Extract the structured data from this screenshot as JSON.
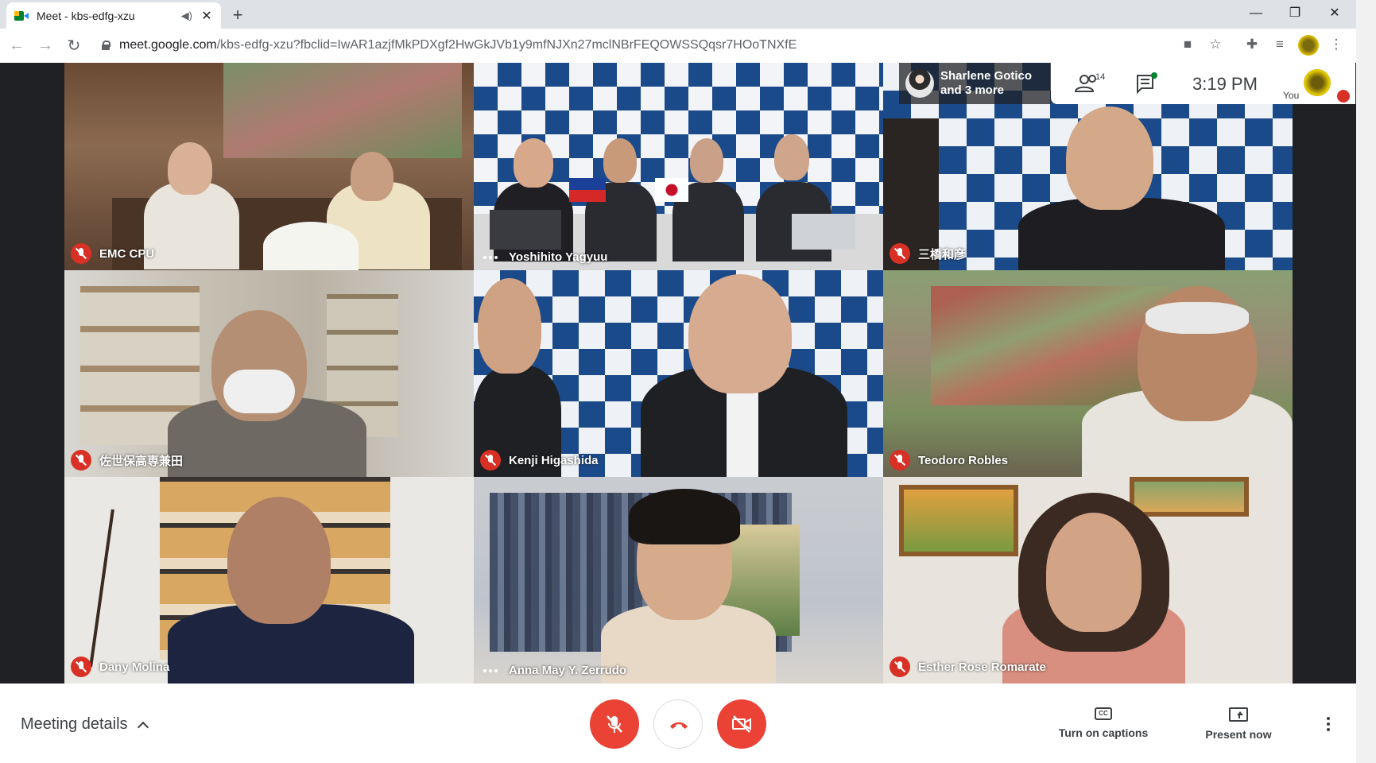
{
  "browser": {
    "tab_title": "Meet - kbs-edfg-xzu",
    "url_host": "meet.google.com",
    "url_rest": "/kbs-edfg-xzu?fbclid=IwAR1azjfMkPDXgf2HwGkJVb1y9mfNJXn27mclNBrFEQOWSSQqsr7HOoTNXfE",
    "new_tab": "+",
    "tab_close": "✕",
    "minimize": "—",
    "maximize": "❐",
    "close": "✕"
  },
  "top_panel": {
    "presenter_line1": "Sharlene Gotico",
    "presenter_line2": "and 3 more",
    "participant_count": "14",
    "time": "3:19 PM",
    "you_label": "You"
  },
  "participants": [
    {
      "name": "EMC CPU",
      "status": "muted"
    },
    {
      "name": "Yoshihito Yagyuu",
      "status": "speaking"
    },
    {
      "name": "三橋和彦",
      "status": "muted"
    },
    {
      "name": "佐世保高専兼田",
      "status": "muted"
    },
    {
      "name": "Kenji Higashida",
      "status": "muted"
    },
    {
      "name": "Teodoro Robles",
      "status": "muted"
    },
    {
      "name": "Dany Molina",
      "status": "muted"
    },
    {
      "name": "Anna May Y. Zerrudo",
      "status": "speaking"
    },
    {
      "name": "Esther Rose Romarate",
      "status": "muted"
    }
  ],
  "bottom_bar": {
    "meeting_details": "Meeting details",
    "captions": "Turn on captions",
    "present": "Present now",
    "cc": "CC"
  },
  "colors": {
    "accent_red": "#ea4335",
    "meet_green": "#00832d"
  }
}
